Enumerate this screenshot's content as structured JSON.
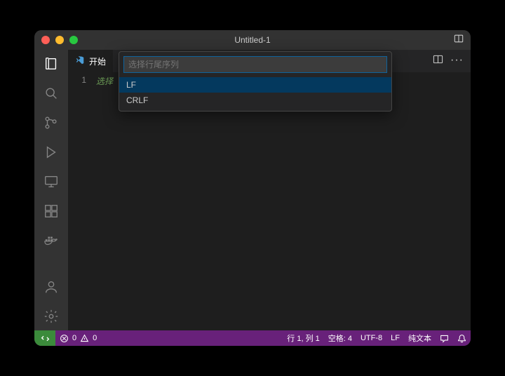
{
  "titlebar": {
    "title": "Untitled-1"
  },
  "tab": {
    "label": "开始"
  },
  "editor": {
    "line_number": "1",
    "placeholder_text": "选择"
  },
  "quickpick": {
    "placeholder": "选择行尾序列",
    "items": [
      {
        "label": "LF",
        "selected": true
      },
      {
        "label": "CRLF",
        "selected": false
      }
    ]
  },
  "status": {
    "errors": "0",
    "warnings": "0",
    "cursor": "行 1, 列 1",
    "spaces": "空格: 4",
    "encoding": "UTF-8",
    "eol": "LF",
    "language": "纯文本"
  }
}
